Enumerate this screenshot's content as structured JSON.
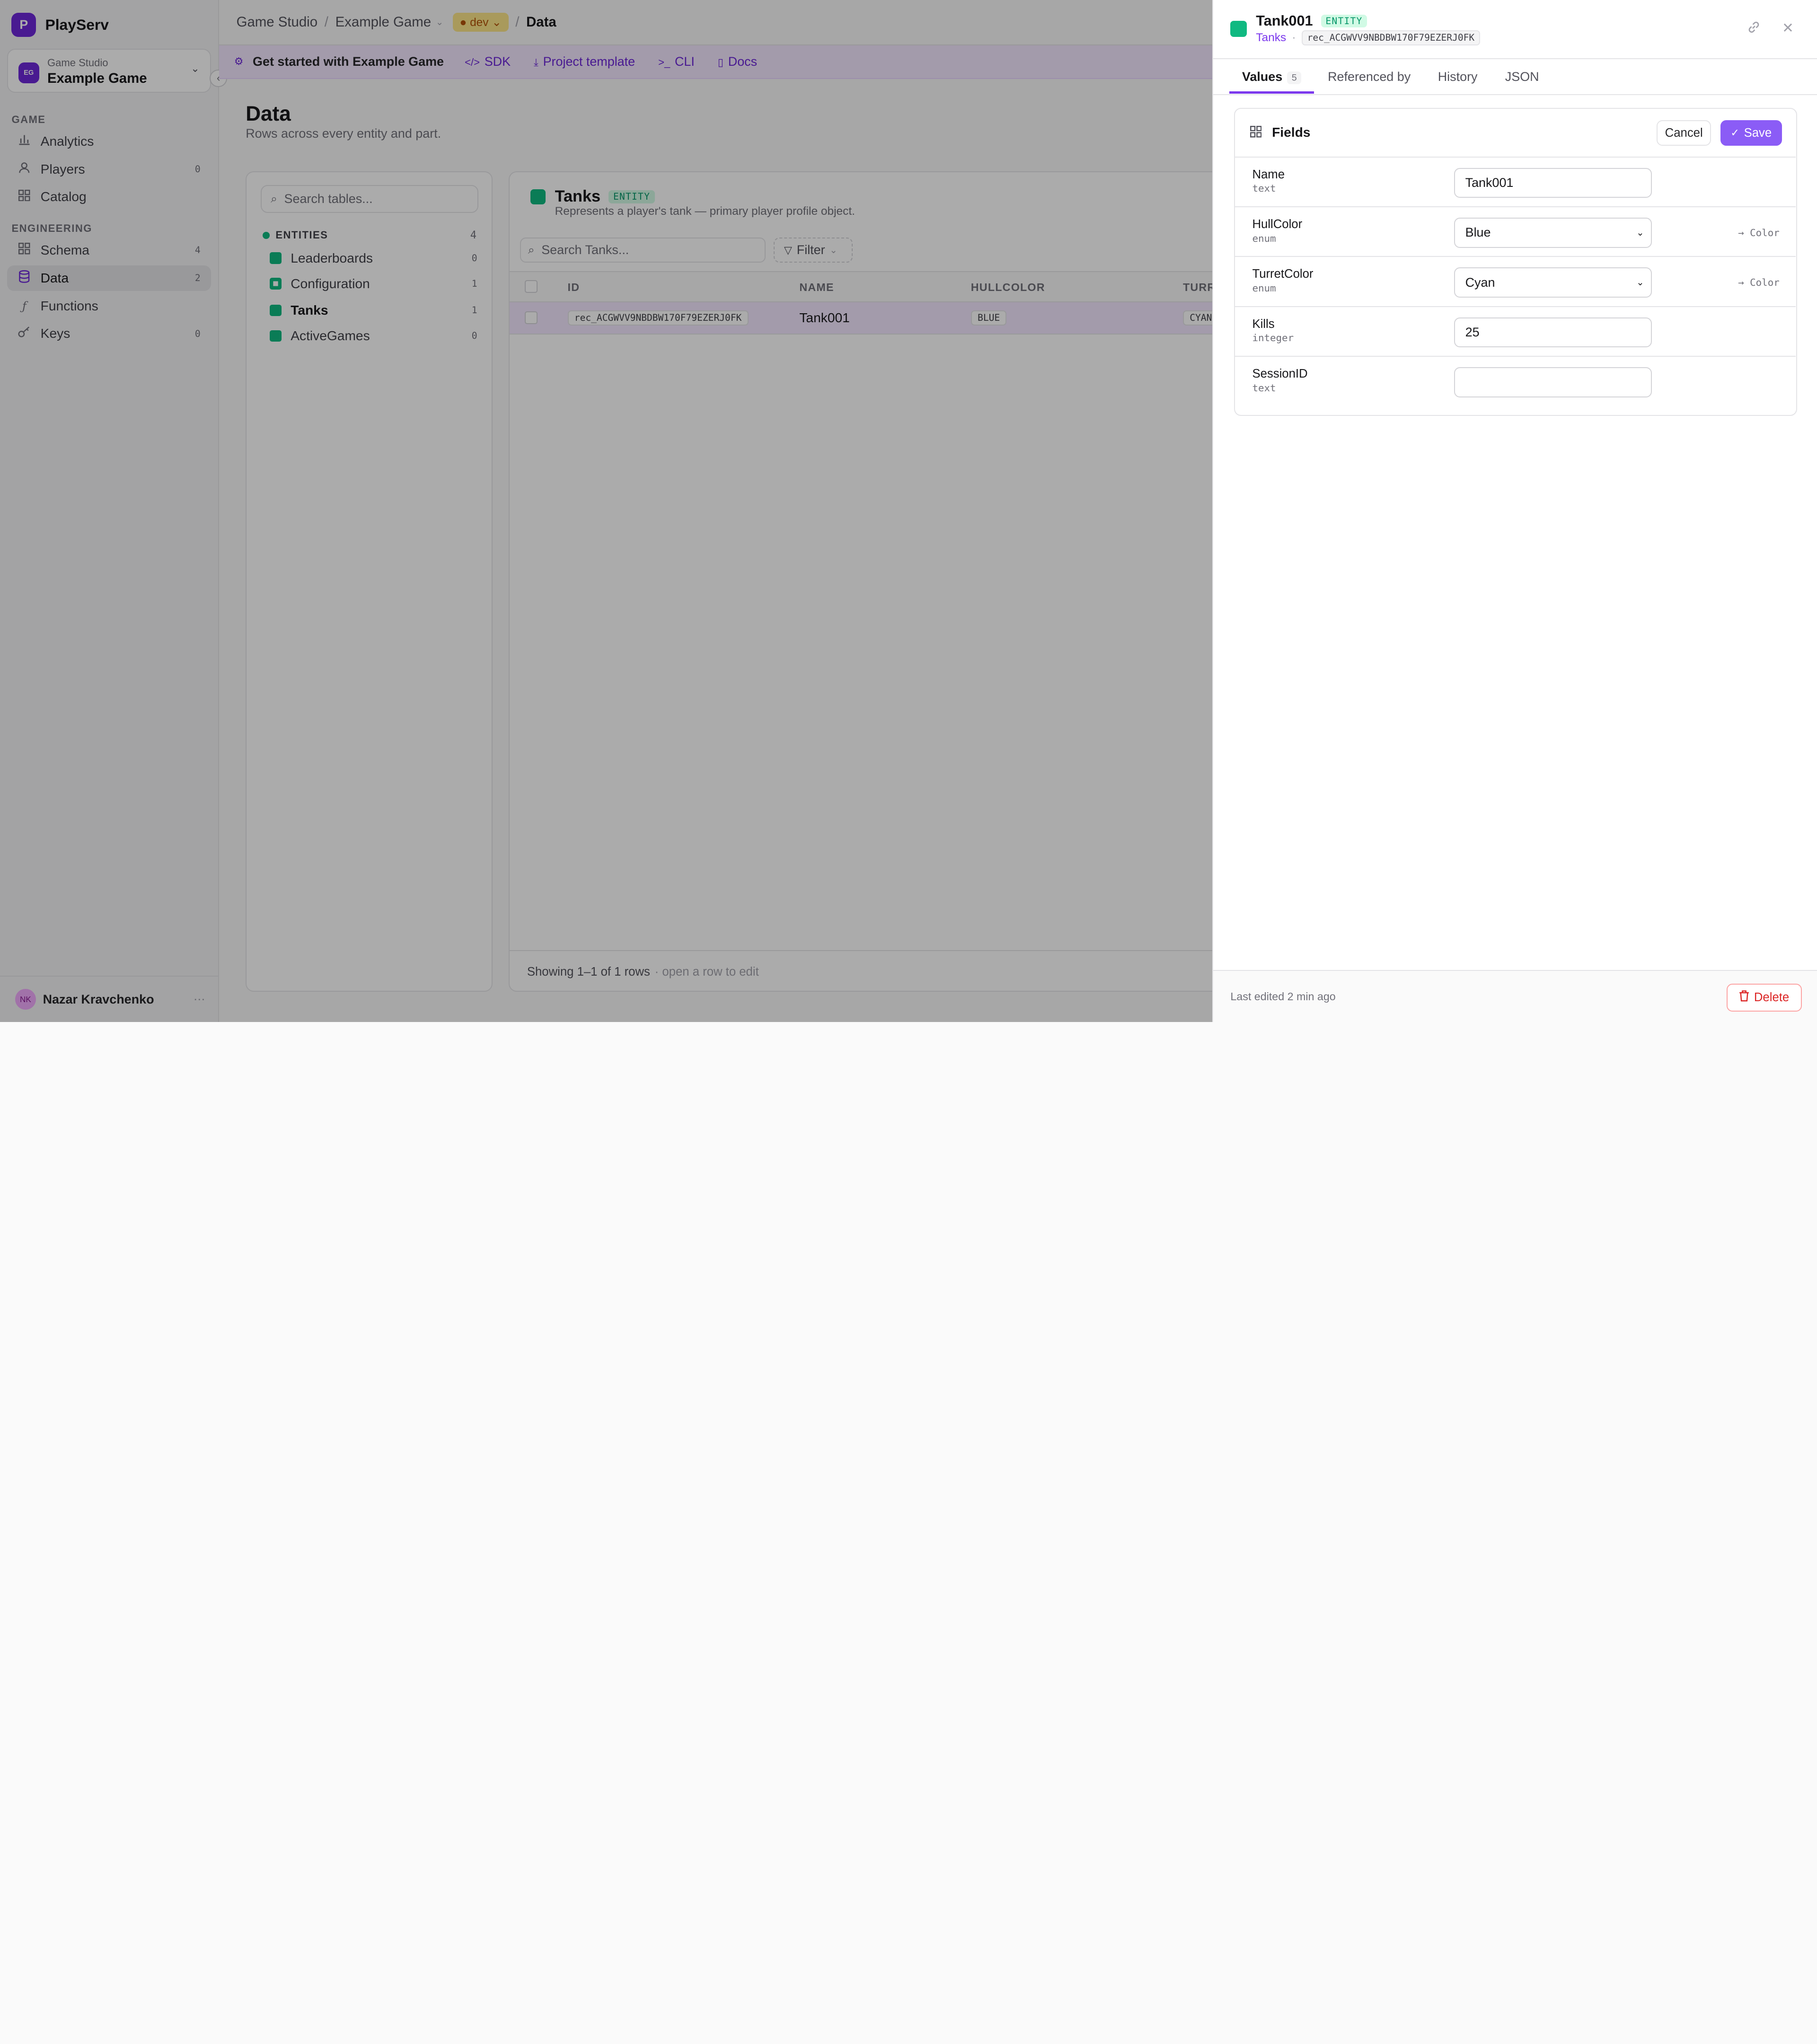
{
  "app": {
    "name": "PlayServ",
    "logo_letter": "P"
  },
  "workspace": {
    "avatar": "EG",
    "org": "Game Studio",
    "project": "Example Game"
  },
  "nav": {
    "game_label": "GAME",
    "engineering_label": "ENGINEERING",
    "analytics": {
      "label": "Analytics",
      "icon": "bar-chart-icon"
    },
    "players": {
      "label": "Players",
      "count": "0",
      "icon": "user-icon"
    },
    "catalog": {
      "label": "Catalog",
      "icon": "grid-icon"
    },
    "schema": {
      "label": "Schema",
      "count": "4",
      "icon": "grid-icon"
    },
    "data": {
      "label": "Data",
      "count": "2",
      "icon": "database-icon"
    },
    "functions": {
      "label": "Functions",
      "icon": "function-icon"
    },
    "keys": {
      "label": "Keys",
      "count": "0",
      "icon": "key-icon"
    }
  },
  "user": {
    "initials": "NK",
    "name": "Nazar Kravchenko"
  },
  "breadcrumb": {
    "org": "Game Studio",
    "project": "Example Game",
    "env": "dev",
    "page": "Data"
  },
  "banner": {
    "title": "Get started with Example Game",
    "sdk": "SDK",
    "template": "Project template",
    "cli": "CLI",
    "docs": "Docs"
  },
  "page": {
    "title": "Data",
    "subtitle": "Rows across every entity and part."
  },
  "tables": {
    "search_placeholder": "Search tables...",
    "entities_label": "ENTITIES",
    "entities_count": "4",
    "items": [
      {
        "name": "Leaderboards",
        "count": "0"
      },
      {
        "name": "Configuration",
        "count": "1"
      },
      {
        "name": "Tanks",
        "count": "1"
      },
      {
        "name": "ActiveGames",
        "count": "0"
      }
    ]
  },
  "grid": {
    "title": "Tanks",
    "badge": "ENTITY",
    "description": "Represents a player's tank — primary player profile object.",
    "search_placeholder": "Search Tanks...",
    "filter_label": "Filter",
    "columns": [
      "ID",
      "NAME",
      "HULLCOLOR",
      "TURR"
    ],
    "row": {
      "id": "rec_ACGWVV9NBDBW170F79EZERJ0FK",
      "name": "Tank001",
      "hull": "BLUE",
      "turret": "CYAN"
    },
    "footer": "Showing 1–1 of 1 rows",
    "footer_hint": "· open a row to edit"
  },
  "drawer": {
    "title": "Tank001",
    "badge": "ENTITY",
    "table": "Tanks",
    "record_id": "rec_ACGWVV9NBDBW170F79EZERJ0FK",
    "tabs": {
      "values": "Values",
      "values_count": "5",
      "referenced": "Referenced by",
      "history": "History",
      "json": "JSON"
    },
    "card_title": "Fields",
    "cancel": "Cancel",
    "save": "Save",
    "fields": [
      {
        "name": "Name",
        "type": "text",
        "value": "Tank001"
      },
      {
        "name": "HullColor",
        "type": "enum",
        "value": "Blue",
        "ref": "→ Color"
      },
      {
        "name": "TurretColor",
        "type": "enum",
        "value": "Cyan",
        "ref": "→ Color"
      },
      {
        "name": "Kills",
        "type": "integer",
        "value": "25"
      },
      {
        "name": "SessionID",
        "type": "text",
        "value": ""
      }
    ],
    "last_edited": "Last edited 2 min ago",
    "delete": "Delete"
  }
}
